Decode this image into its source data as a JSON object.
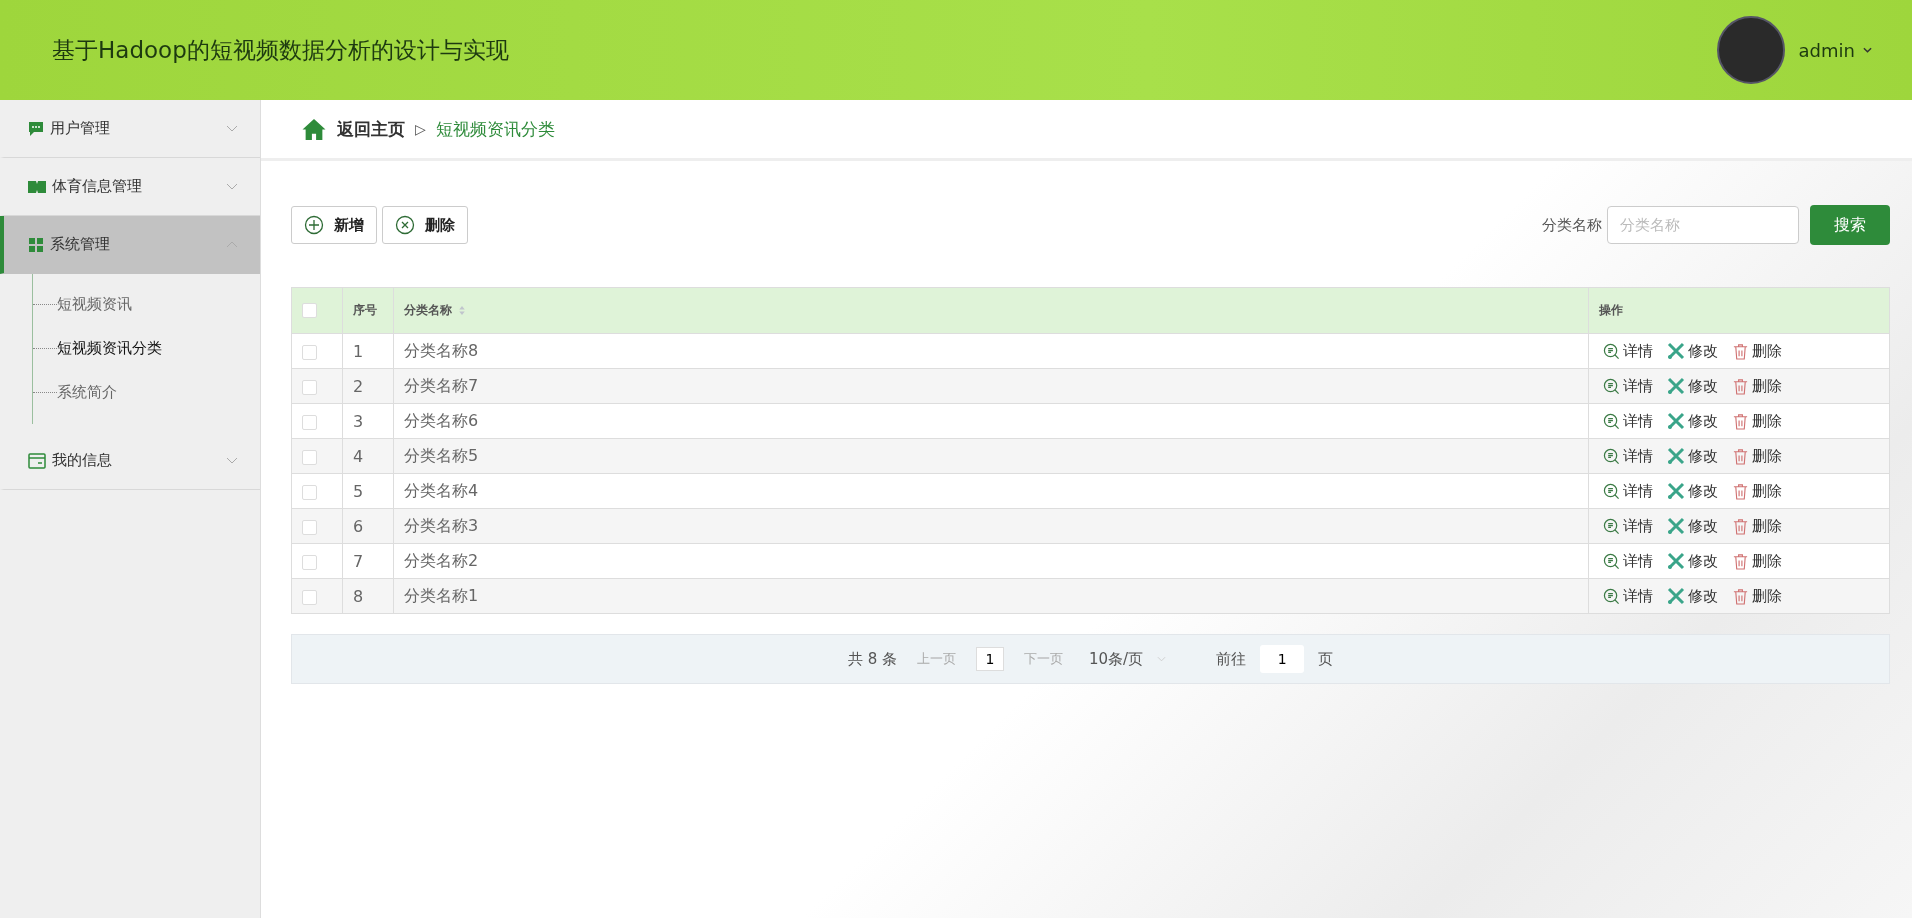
{
  "header": {
    "title": "基于Hadoop的短视频数据分析的设计与实现",
    "user": "admin"
  },
  "sidebar": {
    "items": [
      {
        "label": "用户管理",
        "expanded": false,
        "selected": false
      },
      {
        "label": "体育信息管理",
        "expanded": false,
        "selected": false
      },
      {
        "label": "系统管理",
        "expanded": true,
        "selected": true,
        "children": [
          {
            "label": "短视频资讯",
            "selected": false
          },
          {
            "label": "短视频资讯分类",
            "selected": true
          },
          {
            "label": "系统简介",
            "selected": false
          }
        ]
      },
      {
        "label": "我的信息",
        "expanded": false,
        "selected": false
      }
    ]
  },
  "breadcrumb": {
    "home": "返回主页",
    "separator": "▷",
    "current": "短视频资讯分类"
  },
  "toolbar": {
    "add": "新增",
    "delete": "删除",
    "search_label": "分类名称",
    "search_placeholder": "分类名称",
    "search_button": "搜索"
  },
  "table": {
    "columns": [
      "序号",
      "分类名称",
      "操作"
    ],
    "select_all_checked": false,
    "rows": [
      {
        "index": "1",
        "name": "分类名称8",
        "checked": false,
        "actions": [
          "详情",
          "修改",
          "删除"
        ]
      },
      {
        "index": "2",
        "name": "分类名称7",
        "checked": false,
        "actions": [
          "详情",
          "修改",
          "删除"
        ]
      },
      {
        "index": "3",
        "name": "分类名称6",
        "checked": false,
        "actions": [
          "详情",
          "修改",
          "删除"
        ]
      },
      {
        "index": "4",
        "name": "分类名称5",
        "checked": false,
        "actions": [
          "详情",
          "修改",
          "删除"
        ]
      },
      {
        "index": "5",
        "name": "分类名称4",
        "checked": false,
        "actions": [
          "详情",
          "修改",
          "删除"
        ]
      },
      {
        "index": "6",
        "name": "分类名称3",
        "checked": false,
        "actions": [
          "详情",
          "修改",
          "删除"
        ]
      },
      {
        "index": "7",
        "name": "分类名称2",
        "checked": false,
        "actions": [
          "详情",
          "修改",
          "删除"
        ]
      },
      {
        "index": "8",
        "name": "分类名称1",
        "checked": false,
        "actions": [
          "详情",
          "修改",
          "删除"
        ]
      }
    ]
  },
  "pagination": {
    "total": "共 8 条",
    "prev": "上一页",
    "page": "1",
    "next": "下一页",
    "page_size": "10条/页",
    "goto": "前往",
    "goto_value": "1",
    "page_unit": "页"
  }
}
